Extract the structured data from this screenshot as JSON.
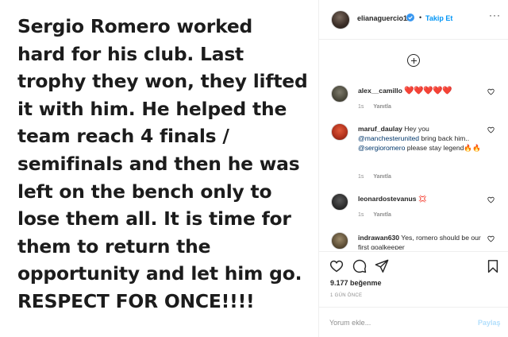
{
  "post_text_lines": [
    "Sergio Romero worked",
    "hard for his club. Last",
    "trophy they won, they lifted",
    "it with him. He helped the",
    "team reach 4 finals /",
    "semifinals and then he was",
    "left on the bench only to",
    "lose them all. It is time for",
    "them to return the",
    "opportunity and let him go.",
    "RESPECT FOR ONCE!!!!"
  ],
  "header": {
    "username": "elianaguercio12",
    "separator": "•",
    "follow_label": "Takip Et",
    "more_label": "···"
  },
  "comments": [
    {
      "username": "alex__camillo",
      "text": "❤️❤️❤️❤️❤️",
      "time": "1s",
      "reply_label": "Yanıtla"
    },
    {
      "username": "maruf_daulay",
      "text_pre": "Hey you",
      "mention1": "@manchesterunited",
      "text_mid": "bring back him..",
      "mention2": "@sergioromero",
      "text_post": "please stay legend🔥🔥",
      "time": "1s",
      "reply_label": "Yanıtla"
    },
    {
      "username": "leonardostevanus",
      "text": "💢",
      "time": "1s",
      "reply_label": "Yanıtla"
    },
    {
      "username": "indrawan630",
      "text": "Yes, romero should be our first goalkeeper"
    }
  ],
  "likes": "9.177 beğenme",
  "time_ago": "1 GÜN ÖNCE",
  "comment_input": {
    "placeholder": "Yorum ekle...",
    "value": ""
  },
  "share_label": "Paylaş",
  "icons": [
    "verified-icon",
    "plus-circle-icon",
    "heart-icon",
    "comment-icon",
    "share-icon",
    "bookmark-icon",
    "more-icon"
  ],
  "colors": {
    "accent": "#0095f6",
    "link": "#00376b",
    "muted": "#8e8e8e",
    "share_disabled": "#b2dffc",
    "heart": "#e0245e"
  }
}
